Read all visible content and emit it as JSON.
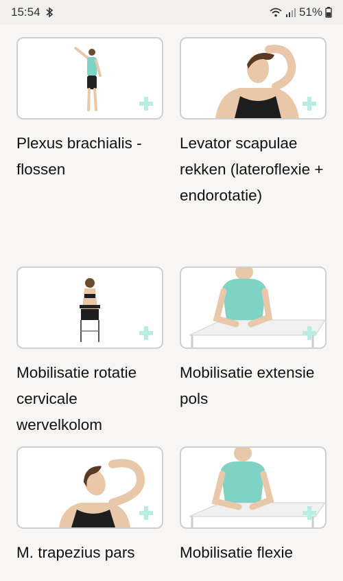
{
  "status_bar": {
    "time": "15:54",
    "battery_percent": "51%",
    "icons": [
      "bluetooth-icon",
      "wifi-icon",
      "signal-icon",
      "battery-icon"
    ]
  },
  "accent_color": "#b9ece3",
  "exercises": [
    {
      "title": "Plexus brachialis - flossen",
      "thumbnail": "person-standing-arm-raised"
    },
    {
      "title": "Levator scapulae rekken (lateroflexie + endorotatie)",
      "thumbnail": "woman-neck-stretch"
    },
    {
      "title": "Mobilisatie rotatie cervicale wervelkolom",
      "thumbnail": "woman-seated-chair-back-view"
    },
    {
      "title": "Mobilisatie extensie pols",
      "thumbnail": "woman-at-table-wrists"
    },
    {
      "title": "M. trapezius pars",
      "thumbnail": "woman-neck-side-stretch"
    },
    {
      "title": "Mobilisatie flexie",
      "thumbnail": "woman-at-table-wrist-flexion"
    }
  ]
}
